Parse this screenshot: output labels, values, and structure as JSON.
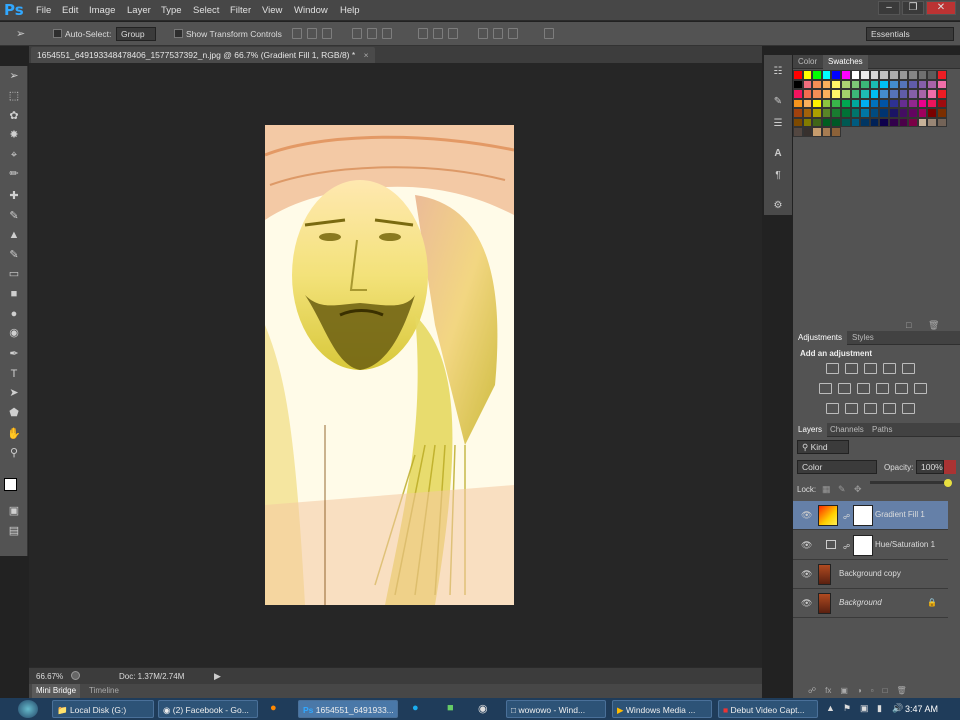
{
  "app": {
    "logo": "Ps",
    "document_tab": "1654551_649193348478406_1577537392_n.jpg @ 66.7% (Gradient Fill 1, RGB/8) *"
  },
  "menu": [
    "File",
    "Edit",
    "Image",
    "Layer",
    "Type",
    "Select",
    "Filter",
    "View",
    "Window",
    "Help"
  ],
  "options": {
    "auto_select": "Auto-Select:",
    "group": "Group",
    "show_transform": "Show Transform Controls",
    "workspace": "Essentials"
  },
  "status": {
    "zoom": "66.67%",
    "doc": "Doc: 1.37M/2.74M"
  },
  "bottom_tabs": [
    "Mini Bridge",
    "Timeline"
  ],
  "panels": {
    "color_tabs": [
      "Color",
      "Swatches"
    ],
    "adj_tabs": [
      "Adjustments",
      "Styles"
    ],
    "adj_title": "Add an adjustment",
    "layer_tabs": [
      "Layers",
      "Channels",
      "Paths"
    ],
    "kind": "Kind",
    "blend": "Color",
    "opacity_label": "Opacity:",
    "opacity": "100%",
    "lock_label": "Lock:"
  },
  "layers": [
    {
      "name": "Gradient Fill 1",
      "selected": true
    },
    {
      "name": "Hue/Saturation 1",
      "selected": false
    },
    {
      "name": "Background copy",
      "selected": false
    },
    {
      "name": "Background",
      "selected": false
    }
  ],
  "swatches": [
    "#ff0000",
    "#ffff00",
    "#00ff00",
    "#00ffff",
    "#0000ff",
    "#ff00ff",
    "#ffffff",
    "#ebebeb",
    "#d6d6d6",
    "#c2c2c2",
    "#adadad",
    "#999999",
    "#858585",
    "#707070",
    "#5c5c5c",
    "#ee1d24",
    "#000000",
    "#f26d7d",
    "#f68e55",
    "#fbaf5c",
    "#fff467",
    "#acd372",
    "#7cc576",
    "#3bb878",
    "#1abbb4",
    "#00bff3",
    "#438ccb",
    "#5574b9",
    "#605ca8",
    "#855fa8",
    "#a763a8",
    "#f06ea9",
    "#f4145e",
    "#f26c4f",
    "#f68e56",
    "#fbaf5d",
    "#fff568",
    "#a3d26b",
    "#3cb878",
    "#1ebbb4",
    "#00bef1",
    "#448ccb",
    "#5673b9",
    "#605ca8",
    "#8560a8",
    "#a864a8",
    "#f06eaa",
    "#ed1c24",
    "#f7941d",
    "#fbaf5c",
    "#fff200",
    "#8dc63f",
    "#39b54a",
    "#00a651",
    "#00a99d",
    "#00aeef",
    "#0072bc",
    "#0054a6",
    "#2e3192",
    "#662d91",
    "#92278f",
    "#ec008c",
    "#ed145b",
    "#9e0b0f",
    "#a0410d",
    "#a3620a",
    "#aba000",
    "#598527",
    "#197b30",
    "#007236",
    "#00746b",
    "#0076a3",
    "#004b80",
    "#003471",
    "#1b1464",
    "#440e62",
    "#630460",
    "#9e005d",
    "#790000",
    "#7b2e00",
    "#7d4900",
    "#827b00",
    "#406618",
    "#005e20",
    "#005826",
    "#005952",
    "#005b7f",
    "#003663",
    "#002157",
    "#0d004c",
    "#32004b",
    "#4b0049",
    "#7b0046",
    "#c7b299",
    "#998675",
    "#736357",
    "#534741",
    "#37302d",
    "#c69c6d",
    "#a67c52",
    "#8c6239"
  ],
  "clock": "3:47 AM",
  "taskbar": [
    "Local Disk (G:)",
    "(2) Facebook - Go...",
    "1654551_6491933...",
    "wowowo - Wind...",
    "Windows Media ...",
    "Debut Video Capt..."
  ]
}
